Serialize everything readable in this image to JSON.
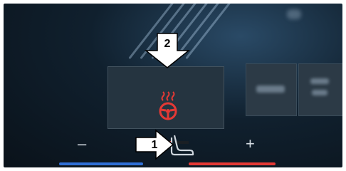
{
  "callouts": {
    "seat_label": "1",
    "tile_label": "2"
  },
  "controls": {
    "minus_label": "–",
    "plus_label": "+"
  },
  "heating_tile": {
    "icon": "heated-steering-wheel-icon",
    "level_fraction": 0.67
  },
  "colors": {
    "heat": "#e53935",
    "cool": "#2f6fd6",
    "panel": "#253440"
  }
}
